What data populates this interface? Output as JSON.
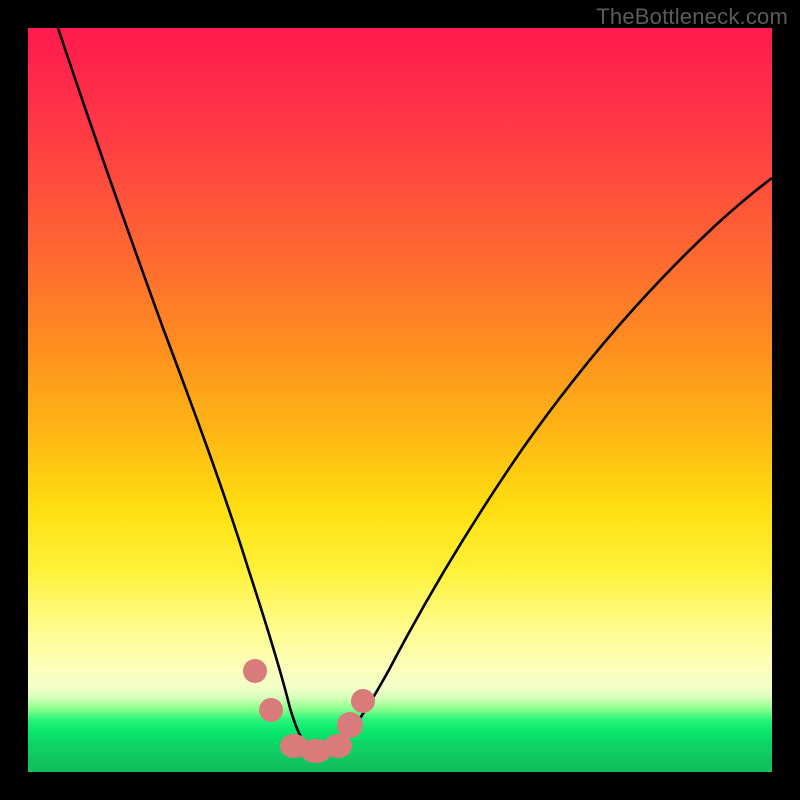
{
  "watermark": "TheBottleneck.com",
  "chart_data": {
    "type": "line",
    "title": "",
    "xlabel": "",
    "ylabel": "",
    "xlim": [
      0,
      100
    ],
    "ylim": [
      0,
      100
    ],
    "grid": false,
    "series": [
      {
        "name": "bottleneck-curve",
        "x": [
          4,
          8,
          12,
          16,
          20,
          24,
          27,
          30,
          32,
          34,
          35.5,
          37,
          39,
          41,
          45,
          50,
          56,
          63,
          72,
          82,
          92,
          100
        ],
        "values": [
          100,
          88,
          75,
          62,
          48,
          35,
          24,
          14,
          8,
          4,
          3,
          3,
          4,
          5,
          8,
          13,
          20,
          29,
          40,
          52,
          63,
          71
        ]
      }
    ],
    "markers": [
      {
        "name": "left-upper-dot",
        "x": 30.5,
        "y": 13,
        "r": 1.7
      },
      {
        "name": "left-lower-dot",
        "x": 32.5,
        "y": 8,
        "r": 1.7
      },
      {
        "name": "trough-blob",
        "x": 37,
        "y": 3.2,
        "r": 2.5,
        "elongated": true
      },
      {
        "name": "right-lower-dot",
        "x": 42,
        "y": 6,
        "r": 1.9
      },
      {
        "name": "right-upper-dot",
        "x": 44.5,
        "y": 8.5,
        "r": 1.7
      }
    ],
    "marker_color": "#d97b7b",
    "curve_color": "#000000"
  }
}
